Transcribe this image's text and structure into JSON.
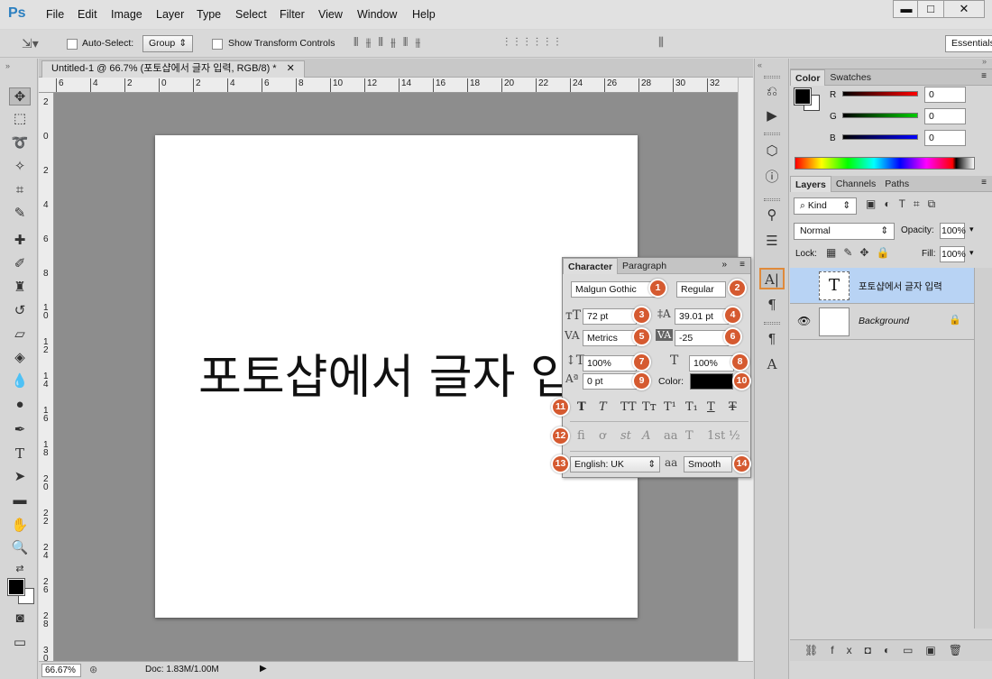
{
  "app": {
    "logo": "Ps"
  },
  "menu": [
    "File",
    "Edit",
    "Image",
    "Layer",
    "Type",
    "Select",
    "Filter",
    "View",
    "Window",
    "Help"
  ],
  "window_controls": {
    "minimize": "▬",
    "maximize": "□",
    "close": "✕"
  },
  "options_bar": {
    "auto_select_label": "Auto-Select:",
    "auto_select_value": "Group",
    "transform_label": "Show Transform Controls",
    "workspace": "Essentials"
  },
  "document": {
    "tab_title": "Untitled-1 @ 66.7% (포토샵에서 글자 입력, RGB/8) *",
    "text_content": "포토샵에서 글자 입",
    "zoom": "66.67%",
    "doc_size": "Doc: 1.83M/1.00M"
  },
  "ruler_h": [
    "6",
    "4",
    "2",
    "0",
    "2",
    "4",
    "6",
    "8",
    "10",
    "12",
    "14",
    "16",
    "18",
    "20",
    "22",
    "24",
    "26",
    "28",
    "30",
    "32"
  ],
  "ruler_v": [
    "2",
    "0",
    "2",
    "4",
    "6",
    "8",
    "1 0",
    "1 2",
    "1 4",
    "1 6",
    "1 8",
    "2 0",
    "2 2",
    "2 4",
    "2 6",
    "2 8",
    "3 0"
  ],
  "color_panel": {
    "tabs": [
      "Color",
      "Swatches"
    ],
    "r_label": "R",
    "g_label": "G",
    "b_label": "B",
    "r": "0",
    "g": "0",
    "b": "0"
  },
  "layers_panel": {
    "tabs": [
      "Layers",
      "Channels",
      "Paths"
    ],
    "kind": "Kind",
    "blend_mode": "Normal",
    "opacity_label": "Opacity:",
    "opacity": "100%",
    "lock_label": "Lock:",
    "fill_label": "Fill:",
    "fill": "100%",
    "layers": [
      {
        "name": "포토샵에서 글자 입력",
        "thumb": "T"
      },
      {
        "name": "Background",
        "thumb": ""
      }
    ]
  },
  "character_panel": {
    "tabs": [
      "Character",
      "Paragraph"
    ],
    "font_family": "Malgun Gothic",
    "font_style": "Regular",
    "font_size": "72 pt",
    "leading": "39.01 pt",
    "kerning": "Metrics",
    "tracking": "-25",
    "vertical_scale": "100%",
    "horizontal_scale": "100%",
    "baseline_shift": "0 pt",
    "color_label": "Color:",
    "language": "English: UK",
    "antialias_icon": "aa",
    "antialias": "Smooth",
    "style_glyphs": [
      "T",
      "T",
      "TT",
      "Tт",
      "T¹",
      "T₁",
      "T",
      "Ŧ"
    ],
    "opentype_glyphs": [
      "fi",
      "ơ",
      "st",
      "A",
      "aa",
      "T",
      "1st",
      "½"
    ],
    "badges": [
      "1",
      "2",
      "3",
      "4",
      "5",
      "6",
      "7",
      "8",
      "9",
      "10",
      "11",
      "12",
      "13",
      "14"
    ]
  },
  "colors": {
    "accent_orange": "#d55a30",
    "layer_selected": "#b8d3f4",
    "ps_blue": "#2a7fc0"
  }
}
